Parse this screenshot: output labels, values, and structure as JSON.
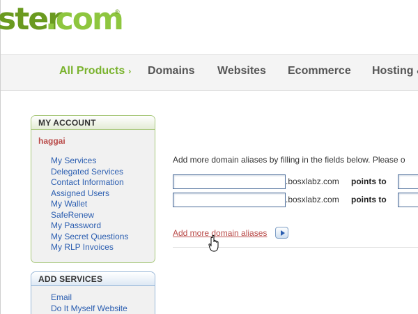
{
  "logo": {
    "part1": "ster",
    "part2": ".com",
    "reg": "®"
  },
  "nav": {
    "items": [
      {
        "label": "All Products",
        "arrow": "›"
      },
      {
        "label": "Domains"
      },
      {
        "label": "Websites"
      },
      {
        "label": "Ecommerce"
      },
      {
        "label": "Hosting &"
      }
    ]
  },
  "account": {
    "heading": "MY ACCOUNT",
    "username": "haggai",
    "links": [
      "My Services",
      "Delegated Services",
      "Contact Information",
      "Assigned Users",
      "My Wallet",
      "SafeRenew",
      "My Password",
      "My Secret Questions",
      "My RLP Invoices"
    ]
  },
  "add_services": {
    "heading": "ADD SERVICES",
    "links": [
      "Email",
      "Do It Myself Website"
    ]
  },
  "main": {
    "intro": "Add more domain aliases by filling in the fields below. Please o",
    "rows": [
      {
        "value": "",
        "suffix": ".bosxlabz.com",
        "points_label": "points to",
        "target": ""
      },
      {
        "value": "",
        "suffix": ".bosxlabz.com",
        "points_label": "points to",
        "target": ""
      }
    ],
    "add_more_label": "Add more domain aliases"
  },
  "colors": {
    "brand_dark_green": "#6a9a1f",
    "brand_green": "#8ec63f",
    "nav_active": "#7ab32e",
    "link_blue": "#2a5db0",
    "link_red": "#b94a48"
  },
  "icons": {
    "play_button": "triangle-right",
    "cursor": "hand-pointer"
  }
}
